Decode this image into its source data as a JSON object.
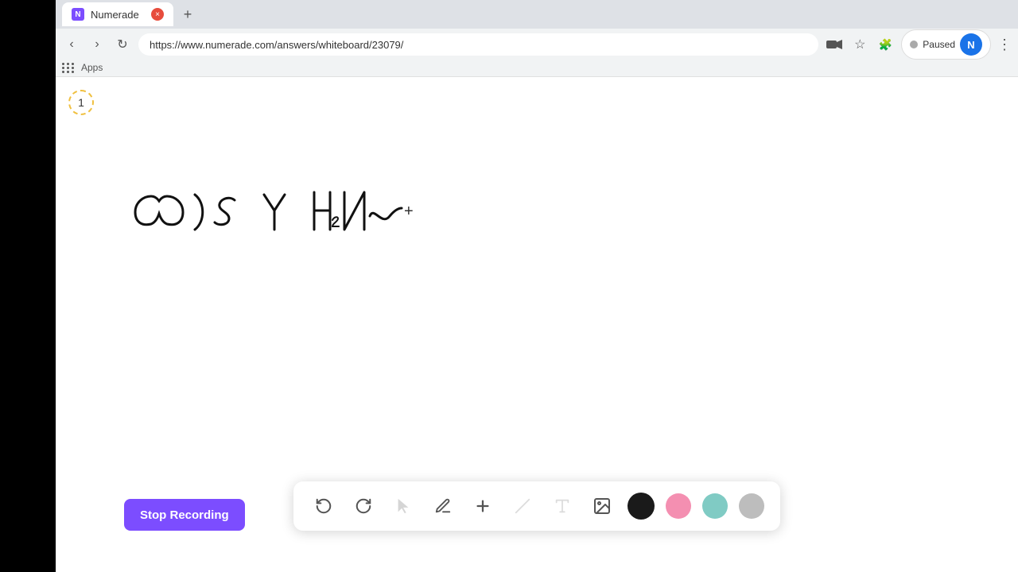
{
  "browser": {
    "tab": {
      "favicon_label": "N",
      "title": "Numerade",
      "close_label": "×"
    },
    "new_tab_label": "+",
    "address": "https://www.numerade.com/answers/whiteboard/23079/",
    "nav": {
      "back": "‹",
      "forward": "›",
      "refresh": "↻"
    },
    "paused_label": "Paused",
    "user_initial": "N",
    "more_label": "⋮"
  },
  "apps_bar": {
    "label": "Apps"
  },
  "page_number": "1",
  "toolbar": {
    "undo_label": "↺",
    "redo_label": "↻",
    "select_label": "▲",
    "pen_label": "✏",
    "plus_label": "+",
    "eraser_label": "/",
    "text_label": "T",
    "image_label": "🖼",
    "colors": [
      {
        "name": "black",
        "value": "#1a1a1a"
      },
      {
        "name": "pink",
        "value": "#f48fb1"
      },
      {
        "name": "green",
        "value": "#80cbc4"
      },
      {
        "name": "gray",
        "value": "#bdbdbd"
      }
    ]
  },
  "stop_recording": {
    "label": "Stop Recording"
  }
}
